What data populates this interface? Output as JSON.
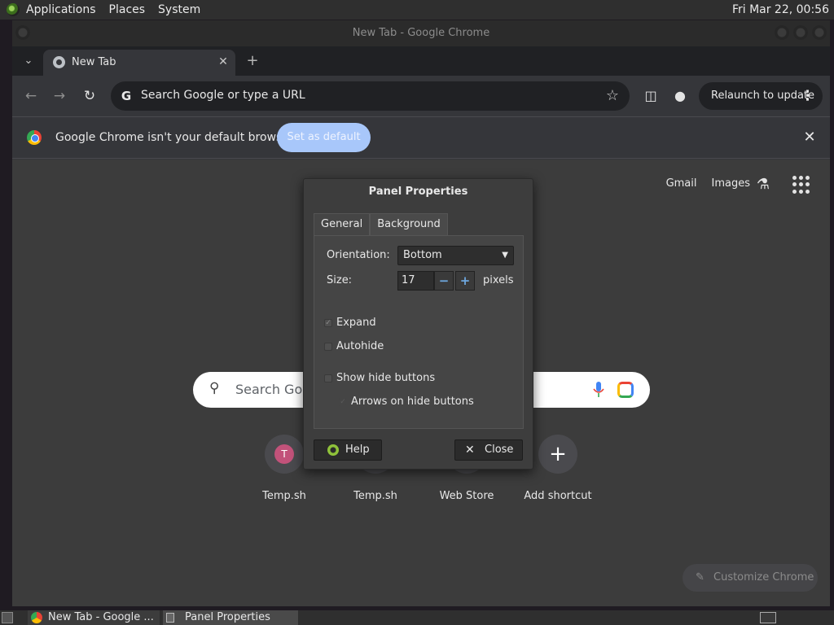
{
  "top_panel": {
    "menus": [
      "Applications",
      "Places",
      "System"
    ],
    "clock": "Fri Mar 22, 00:56"
  },
  "chrome": {
    "window_title": "New Tab - Google Chrome",
    "tab_title": "New Tab",
    "omnibox_placeholder": "Search Google or type a URL",
    "relaunch_label": "Relaunch to update",
    "infobar": {
      "message": "Google Chrome isn't your default browser",
      "button": "Set as default"
    },
    "ntp": {
      "links": [
        "Gmail",
        "Images"
      ],
      "search_placeholder": "Search Goo",
      "shortcuts": [
        {
          "label": "Temp.sh",
          "avatar": "T"
        },
        {
          "label": "Temp.sh",
          "avatar": ""
        },
        {
          "label": "Web Store",
          "avatar": ""
        },
        {
          "label": "Add shortcut",
          "avatar": "+"
        }
      ],
      "customize_label": "Customize Chrome"
    }
  },
  "dialog": {
    "title": "Panel Properties",
    "tabs": [
      "General",
      "Background"
    ],
    "orientation_label": "Orientation:",
    "orientation_value": "Bottom",
    "size_label": "Size:",
    "size_value": "17",
    "size_unit": "pixels",
    "options": [
      {
        "label": "Expand",
        "checked": true,
        "enabled": true
      },
      {
        "label": "Autohide",
        "checked": false,
        "enabled": true
      },
      {
        "label": "Show hide buttons",
        "checked": false,
        "enabled": true
      },
      {
        "label": "Arrows on hide buttons",
        "checked": true,
        "enabled": false
      }
    ],
    "help_label": "Help",
    "close_label": "Close"
  },
  "taskbar": {
    "tasks": [
      "New Tab - Google ...",
      "Panel Properties"
    ]
  },
  "colors": {
    "accent_button": "#a8c7fa",
    "spin_accent": "#6ea8e0"
  }
}
